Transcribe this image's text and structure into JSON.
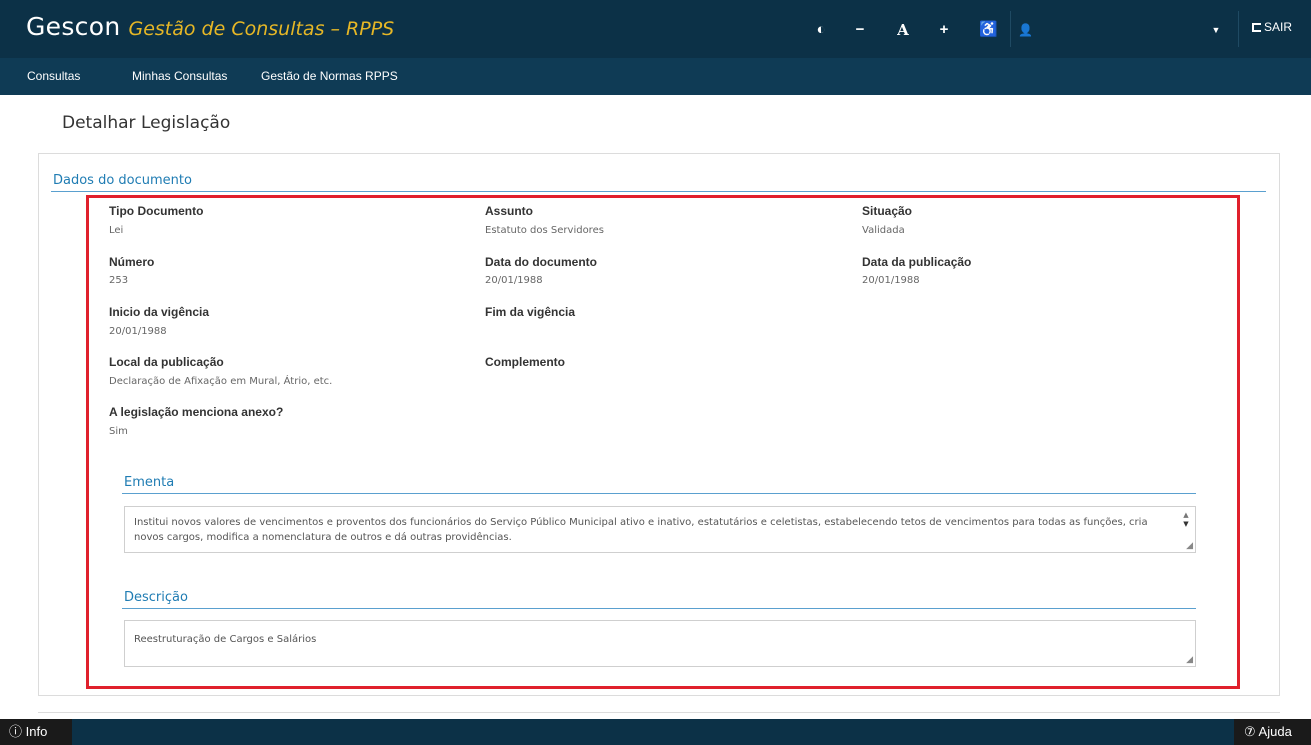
{
  "header": {
    "brand": "Gescon",
    "subtitle": "Gestão de Consultas – RPPS",
    "icons": [
      "contrast-icon",
      "decrease-font-icon",
      "font-icon",
      "increase-font-icon",
      "accessibility-icon",
      "user-icon",
      "chevron-down-icon",
      "logout-icon"
    ],
    "contrast_glyph": "◐",
    "decrease_glyph": "−",
    "font_glyph": "A",
    "increase_glyph": "+",
    "accessibility_glyph": "♿",
    "user_glyph": "👤",
    "chevron_glyph": "▼",
    "logout_label": "SAIR"
  },
  "nav": {
    "items": [
      "Consultas",
      "Minhas Consultas",
      "Gestão de Normas RPPS"
    ]
  },
  "page": {
    "title": "Detalhar Legislação"
  },
  "documento": {
    "section_title": "Dados do documento",
    "fields": {
      "tipo_documento": {
        "label": "Tipo Documento",
        "value": "Lei"
      },
      "assunto": {
        "label": "Assunto",
        "value": "Estatuto dos Servidores"
      },
      "situacao": {
        "label": "Situação",
        "value": "Validada"
      },
      "numero": {
        "label": "Número",
        "value": "253"
      },
      "data_documento": {
        "label": "Data do documento",
        "value": "20/01/1988"
      },
      "data_publicacao": {
        "label": "Data da publicação",
        "value": "20/01/1988"
      },
      "inicio_vigencia": {
        "label": "Inicio da vigência",
        "value": "20/01/1988"
      },
      "fim_vigencia": {
        "label": "Fim da vigência",
        "value": ""
      },
      "local_publicacao": {
        "label": "Local da publicação",
        "value": "Declaração de Afixação em Mural, Átrio, etc."
      },
      "complemento": {
        "label": "Complemento",
        "value": ""
      },
      "anexo": {
        "label": "A legislação menciona anexo?",
        "value": "Sim"
      }
    }
  },
  "ementa": {
    "title": "Ementa",
    "text": "Institui novos valores de vencimentos e proventos dos funcionários do Serviço Público Municipal ativo e inativo, estatutários e celetistas, estabelecendo tetos de vencimentos para todas as funções, cria novos cargos, modifica a nomenclatura de outros e dá outras providências."
  },
  "descricao": {
    "title": "Descrição",
    "text": "Reestruturação de Cargos e Salários"
  },
  "footer": {
    "info_label": "ⓘ Info",
    "help_label": "⑦ Ajuda"
  },
  "colors": {
    "header_bg": "#0c3147",
    "nav_bg": "#0f3b55",
    "subtitle": "#e6b726",
    "section_title": "#1f7cb3",
    "highlight": "#e0202c"
  }
}
